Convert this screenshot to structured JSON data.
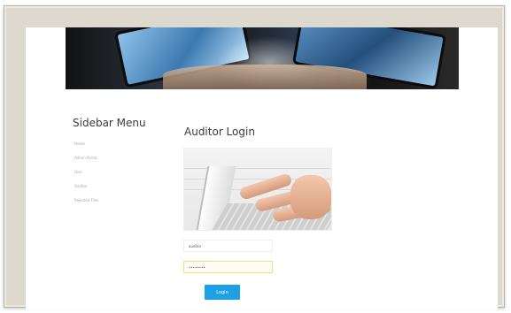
{
  "sidebar": {
    "title": "Sidebar Menu",
    "items": [
      {
        "label": "Home"
      },
      {
        "label": "Admin Portal"
      },
      {
        "label": "User"
      },
      {
        "label": "Auditor"
      },
      {
        "label": "Rejected Files"
      }
    ]
  },
  "main": {
    "heading": "Auditor Login",
    "username_value": "auditor",
    "password_value": "••••••••",
    "login_label": "Login"
  },
  "colors": {
    "accent": "#1ea0e6",
    "frame": "#ddd9cf"
  }
}
